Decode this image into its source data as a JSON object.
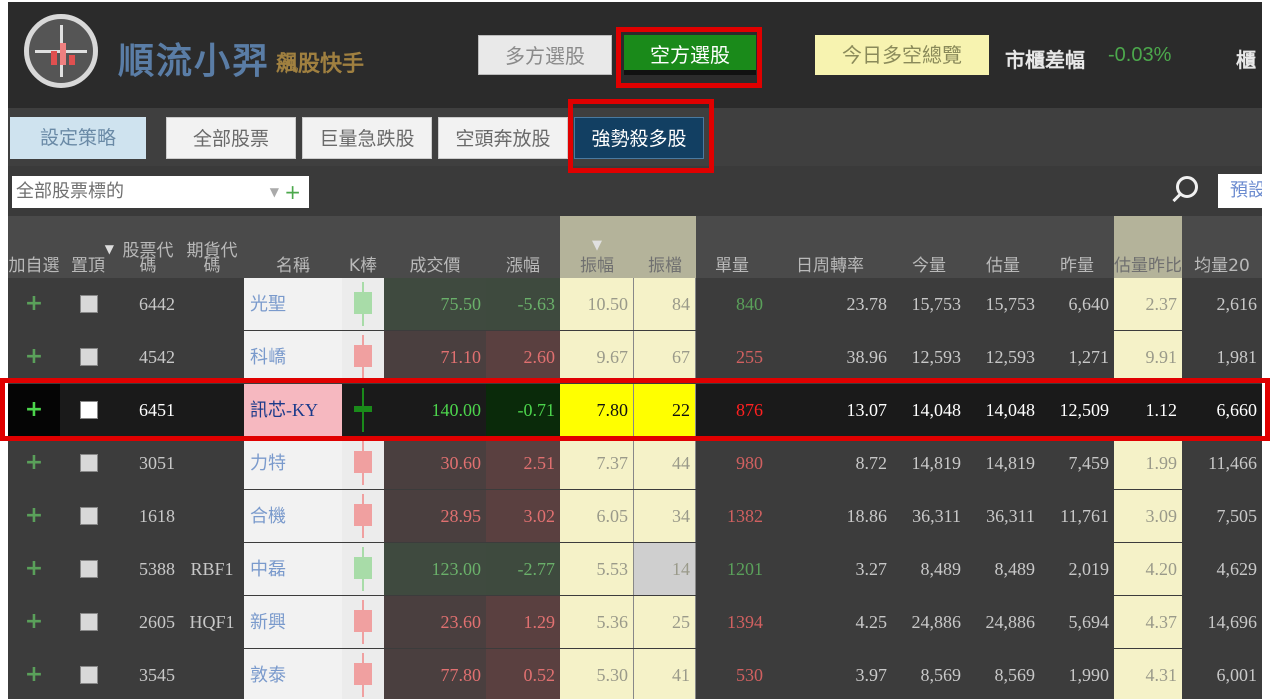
{
  "header": {
    "logo_text": "順流小羿",
    "logo_subtitle": "飆股快手",
    "long_pick_label": "多方選股",
    "short_pick_label": "空方選股",
    "overview_label": "今日多空總覽",
    "spread_label": "市櫃差幅",
    "spread_value": "-0.03%",
    "counter_label": "櫃"
  },
  "strategy_tabs": {
    "settings_label": "設定策略",
    "tabs": [
      {
        "label": "全部股票"
      },
      {
        "label": "巨量急跌股"
      },
      {
        "label": "空頭奔放股"
      },
      {
        "label": "強勢殺多股"
      }
    ]
  },
  "filter": {
    "target_label": "全部股票標的",
    "preset_label": "預設"
  },
  "table": {
    "headers": {
      "add": "加自選",
      "pin": "置頂",
      "code": "股票代碼",
      "futures": "期貨代碼",
      "name": "名稱",
      "kbar": "K棒",
      "price": "成交價",
      "change": "漲幅",
      "amplitude": "振幅",
      "amp_ticks": "振檔",
      "single_vol": "單量",
      "turnover": "日周轉率",
      "today_vol": "今量",
      "est_vol": "估量",
      "prev_vol": "昨量",
      "est_ratio": "估量昨比",
      "avg20": "均量20"
    },
    "add_symbol": "+",
    "rows": [
      {
        "code": "6442",
        "futures": "",
        "name": "光聖",
        "price": "75.50",
        "change": "-5.63",
        "amplitude": "10.50",
        "amp_ticks": "84",
        "single_vol": "840",
        "turnover": "23.78",
        "today_vol": "15,753",
        "est_vol": "15,753",
        "prev_vol": "6,640",
        "est_ratio": "2.37",
        "avg20": "2,616"
      },
      {
        "code": "4542",
        "futures": "",
        "name": "科嶠",
        "price": "71.10",
        "change": "2.60",
        "amplitude": "9.67",
        "amp_ticks": "67",
        "single_vol": "255",
        "turnover": "38.96",
        "today_vol": "12,593",
        "est_vol": "12,593",
        "prev_vol": "1,271",
        "est_ratio": "9.91",
        "avg20": "1,981"
      },
      {
        "code": "6451",
        "futures": "",
        "name": "訊芯-KY",
        "price": "140.00",
        "change": "-0.71",
        "amplitude": "7.80",
        "amp_ticks": "22",
        "single_vol": "876",
        "turnover": "13.07",
        "today_vol": "14,048",
        "est_vol": "14,048",
        "prev_vol": "12,509",
        "est_ratio": "1.12",
        "avg20": "6,660"
      },
      {
        "code": "3051",
        "futures": "",
        "name": "力特",
        "price": "30.60",
        "change": "2.51",
        "amplitude": "7.37",
        "amp_ticks": "44",
        "single_vol": "980",
        "turnover": "8.72",
        "today_vol": "14,819",
        "est_vol": "14,819",
        "prev_vol": "7,459",
        "est_ratio": "1.99",
        "avg20": "11,466"
      },
      {
        "code": "1618",
        "futures": "",
        "name": "合機",
        "price": "28.95",
        "change": "3.02",
        "amplitude": "6.05",
        "amp_ticks": "34",
        "single_vol": "1382",
        "turnover": "18.86",
        "today_vol": "36,311",
        "est_vol": "36,311",
        "prev_vol": "11,761",
        "est_ratio": "3.09",
        "avg20": "7,505"
      },
      {
        "code": "5388",
        "futures": "RBF1",
        "name": "中磊",
        "price": "123.00",
        "change": "-2.77",
        "amplitude": "5.53",
        "amp_ticks": "14",
        "single_vol": "1201",
        "turnover": "3.27",
        "today_vol": "8,489",
        "est_vol": "8,489",
        "prev_vol": "2,019",
        "est_ratio": "4.20",
        "avg20": "4,629"
      },
      {
        "code": "2605",
        "futures": "HQF1",
        "name": "新興",
        "price": "23.60",
        "change": "1.29",
        "amplitude": "5.36",
        "amp_ticks": "25",
        "single_vol": "1394",
        "turnover": "4.25",
        "today_vol": "24,886",
        "est_vol": "24,886",
        "prev_vol": "5,694",
        "est_ratio": "4.37",
        "avg20": "14,696"
      },
      {
        "code": "3545",
        "futures": "",
        "name": "敦泰",
        "price": "77.80",
        "change": "0.52",
        "amplitude": "5.30",
        "amp_ticks": "41",
        "single_vol": "530",
        "turnover": "3.97",
        "today_vol": "8,569",
        "est_vol": "8,569",
        "prev_vol": "1,990",
        "est_ratio": "4.31",
        "avg20": "6,001"
      }
    ]
  },
  "colors": {
    "accent_green": "#1a8a1a",
    "highlight_red": "#e00000",
    "active_tab": "#123f62",
    "highlight_yellow": "#ffff00"
  }
}
